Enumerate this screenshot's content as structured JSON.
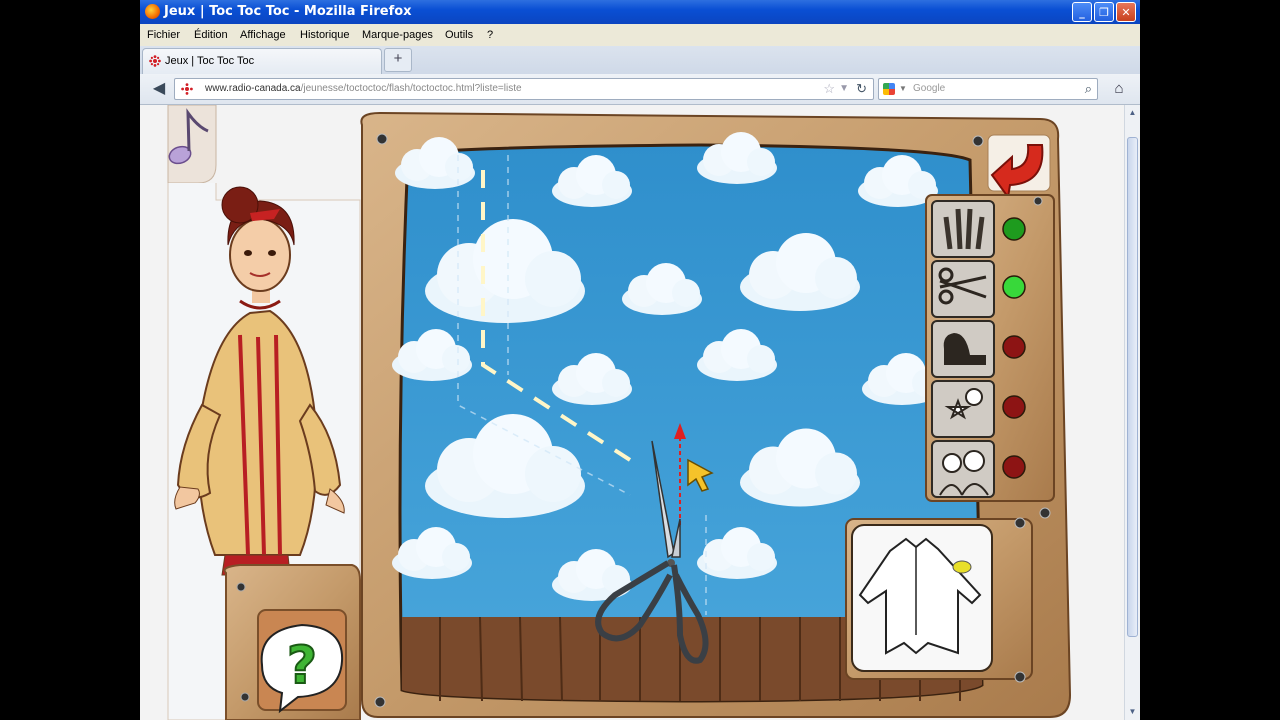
{
  "window": {
    "title": "Jeux | Toc Toc Toc - Mozilla Firefox"
  },
  "menu": [
    "Fichier",
    "Édition",
    "Affichage",
    "Historique",
    "Marque-pages",
    "Outils",
    "?"
  ],
  "tab": {
    "label": "Jeux | Toc Toc Toc",
    "new_tab": "+"
  },
  "address": {
    "domain": "www.radio-canada.ca",
    "path": "/jeunesse/toctoctoc/flash/toctoctoc.html?liste=liste"
  },
  "search": {
    "placeholder": "Google"
  },
  "game": {
    "tools": [
      {
        "name": "pencils",
        "status": "complete"
      },
      {
        "name": "scissors",
        "status": "active"
      },
      {
        "name": "sewing-machine",
        "status": "locked"
      },
      {
        "name": "decorations",
        "status": "locked"
      },
      {
        "name": "characters",
        "status": "locked"
      }
    ],
    "status_colors": {
      "complete": "#1e9b1e",
      "active": "#38d83a",
      "locked": "#8d1414"
    },
    "preview_item": "coat",
    "help_label": "?"
  }
}
